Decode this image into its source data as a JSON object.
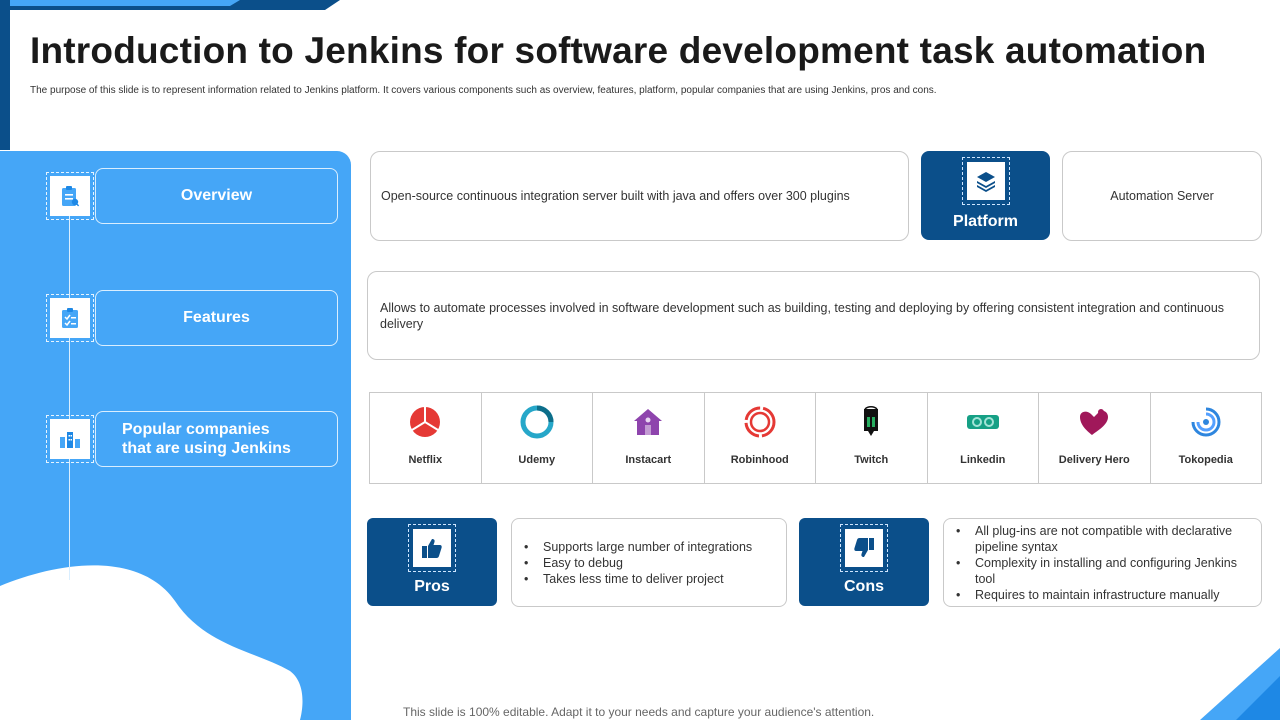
{
  "header": {
    "title": "Introduction to Jenkins for software development task automation",
    "subtitle": "The purpose of this slide is to represent information related to Jenkins platform. It covers various components such as overview, features, platform, popular companies that are using Jenkins, pros and cons."
  },
  "sidebar": {
    "items": [
      {
        "label": "Overview",
        "icon": "clipboard-icon"
      },
      {
        "label": "Features",
        "icon": "checklist-icon"
      },
      {
        "label": "Popular companies that are using Jenkins",
        "line1": "Popular companies",
        "line2": "that are using Jenkins",
        "icon": "building-chart-icon"
      }
    ]
  },
  "overview": {
    "text": "Open-source continuous integration server built with java and offers over 300 plugins"
  },
  "platform": {
    "label": "Platform",
    "value": "Automation Server",
    "icon": "layers-icon"
  },
  "features": {
    "text": "Allows to automate processes involved in software development such as building, testing and deploying by offering consistent integration and continuous delivery"
  },
  "companies": [
    {
      "name": "Netflix",
      "icon": "netflix-logo-icon"
    },
    {
      "name": "Udemy",
      "icon": "udemy-logo-icon"
    },
    {
      "name": "Instacart",
      "icon": "instacart-logo-icon"
    },
    {
      "name": "Robinhood",
      "icon": "robinhood-logo-icon"
    },
    {
      "name": "Twitch",
      "icon": "twitch-logo-icon"
    },
    {
      "name": "Linkedin",
      "icon": "linkedin-logo-icon"
    },
    {
      "name": "Delivery Hero",
      "icon": "delivery-hero-logo-icon"
    },
    {
      "name": "Tokopedia",
      "icon": "tokopedia-logo-icon"
    }
  ],
  "pros": {
    "label": "Pros",
    "icon": "thumbs-up-icon",
    "items": [
      "Supports large number of integrations",
      "Easy to debug",
      "Takes less time to deliver project"
    ]
  },
  "cons": {
    "label": "Cons",
    "icon": "thumbs-down-icon",
    "items": [
      "All plug-ins are not compatible with declarative pipeline syntax",
      "Complexity in installing and configuring Jenkins tool",
      "Requires to maintain infrastructure manually"
    ]
  },
  "footer": {
    "text": "This slide is 100% editable. Adapt it to your needs and capture your audience's attention."
  },
  "colors": {
    "panel_blue": "#45a6f7",
    "dark_blue": "#0b4f8a",
    "accent_bright": "#1e88e5"
  }
}
